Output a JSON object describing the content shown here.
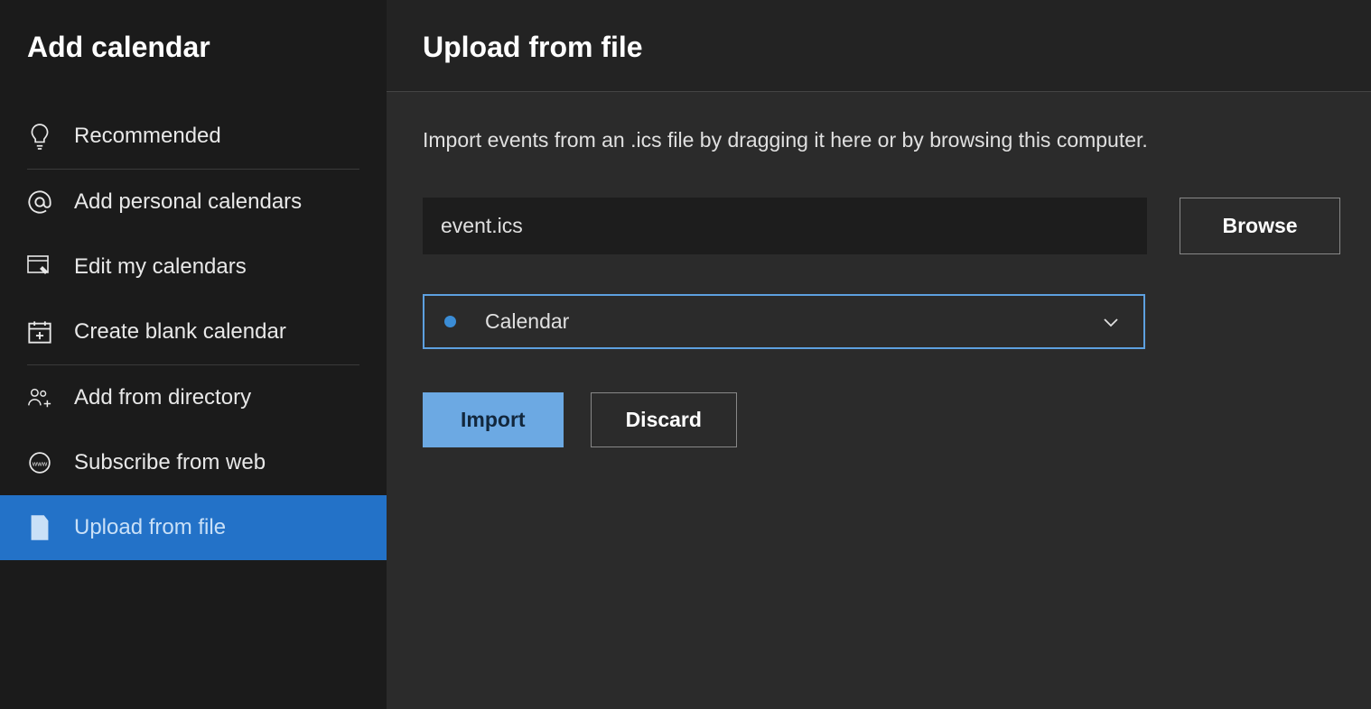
{
  "sidebar": {
    "title": "Add calendar",
    "items": [
      {
        "label": "Recommended",
        "icon": "lightbulb",
        "active": false
      },
      {
        "label": "Add personal calendars",
        "icon": "at-sign",
        "active": false
      },
      {
        "label": "Edit my calendars",
        "icon": "edit-window",
        "active": false
      },
      {
        "label": "Create blank calendar",
        "icon": "calendar-plus",
        "active": false
      },
      {
        "label": "Add from directory",
        "icon": "people-add",
        "active": false
      },
      {
        "label": "Subscribe from web",
        "icon": "web-badge",
        "active": false
      },
      {
        "label": "Upload from file",
        "icon": "file-upload",
        "active": true
      }
    ]
  },
  "main": {
    "title": "Upload from file",
    "description": "Import events from an .ics file by dragging it here or by browsing this computer.",
    "file_name": "event.ics",
    "browse_label": "Browse",
    "calendar_select": {
      "selected": "Calendar",
      "dot_color": "#3b8dd6"
    },
    "buttons": {
      "import": "Import",
      "discard": "Discard"
    }
  }
}
